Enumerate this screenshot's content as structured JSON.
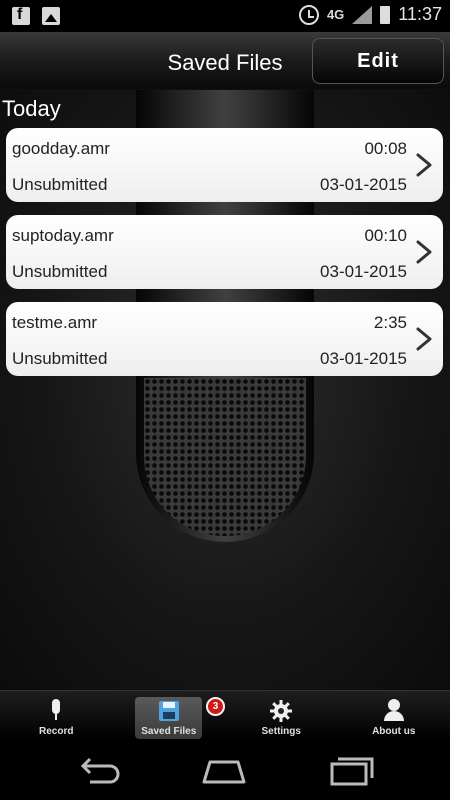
{
  "status_bar": {
    "network": "4G",
    "time": "11:37"
  },
  "header": {
    "title": "Saved Files",
    "edit_label": "Edit"
  },
  "section": {
    "label": "Today"
  },
  "files": [
    {
      "name": "goodday.amr",
      "duration": "00:08",
      "status": "Unsubmitted",
      "date": "03-01-2015"
    },
    {
      "name": "suptoday.amr",
      "duration": "00:10",
      "status": "Unsubmitted",
      "date": "03-01-2015"
    },
    {
      "name": "testme.amr",
      "duration": "2:35",
      "status": "Unsubmitted",
      "date": "03-01-2015"
    }
  ],
  "tabs": [
    {
      "label": "Record",
      "icon": "microphone-icon"
    },
    {
      "label": "Saved Files",
      "icon": "floppy-disk-icon",
      "active": true,
      "badge": "3"
    },
    {
      "label": "Settings",
      "icon": "gear-icon"
    },
    {
      "label": "About us",
      "icon": "user-icon"
    }
  ],
  "colors": {
    "badge": "#d01818",
    "active_tab": "#4a4a4a",
    "card": "#ffffff"
  }
}
